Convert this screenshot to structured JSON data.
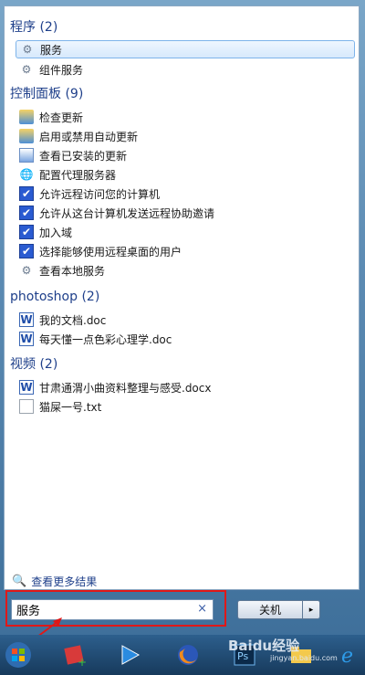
{
  "groups": {
    "programs": {
      "title": "程序 (2)",
      "items": [
        {
          "label": "服务",
          "icon": "gear-icon"
        },
        {
          "label": "组件服务",
          "icon": "component-services-icon"
        }
      ]
    },
    "control_panel": {
      "title": "控制面板 (9)",
      "items": [
        {
          "label": "检查更新",
          "icon": "control-panel-icon"
        },
        {
          "label": "启用或禁用自动更新",
          "icon": "control-panel-icon"
        },
        {
          "label": "查看已安装的更新",
          "icon": "installed-updates-icon"
        },
        {
          "label": "配置代理服务器",
          "icon": "proxy-icon"
        },
        {
          "label": "允许远程访问您的计算机",
          "icon": "remote-access-icon"
        },
        {
          "label": "允许从这台计算机发送远程协助邀请",
          "icon": "remote-access-icon"
        },
        {
          "label": "加入域",
          "icon": "remote-access-icon"
        },
        {
          "label": "选择能够使用远程桌面的用户",
          "icon": "remote-access-icon"
        },
        {
          "label": "查看本地服务",
          "icon": "gear-icon"
        }
      ]
    },
    "photoshop": {
      "title": "photoshop (2)",
      "items": [
        {
          "label": "我的文档.doc",
          "icon": "word-doc-icon"
        },
        {
          "label": "每天懂一点色彩心理学.doc",
          "icon": "word-doc-icon"
        }
      ]
    },
    "video": {
      "title": "视频 (2)",
      "items": [
        {
          "label": "甘肃通渭小曲资料整理与感受.docx",
          "icon": "word-doc-icon"
        },
        {
          "label": "猫屎一号.txt",
          "icon": "text-file-icon"
        }
      ]
    }
  },
  "more_results": "查看更多结果",
  "search": {
    "value": "服务",
    "clear": "×"
  },
  "shutdown": {
    "label": "关机",
    "arrow": "▸"
  },
  "watermark": {
    "main": "Baidu经验",
    "sub": "jingyan.baidu.com"
  }
}
